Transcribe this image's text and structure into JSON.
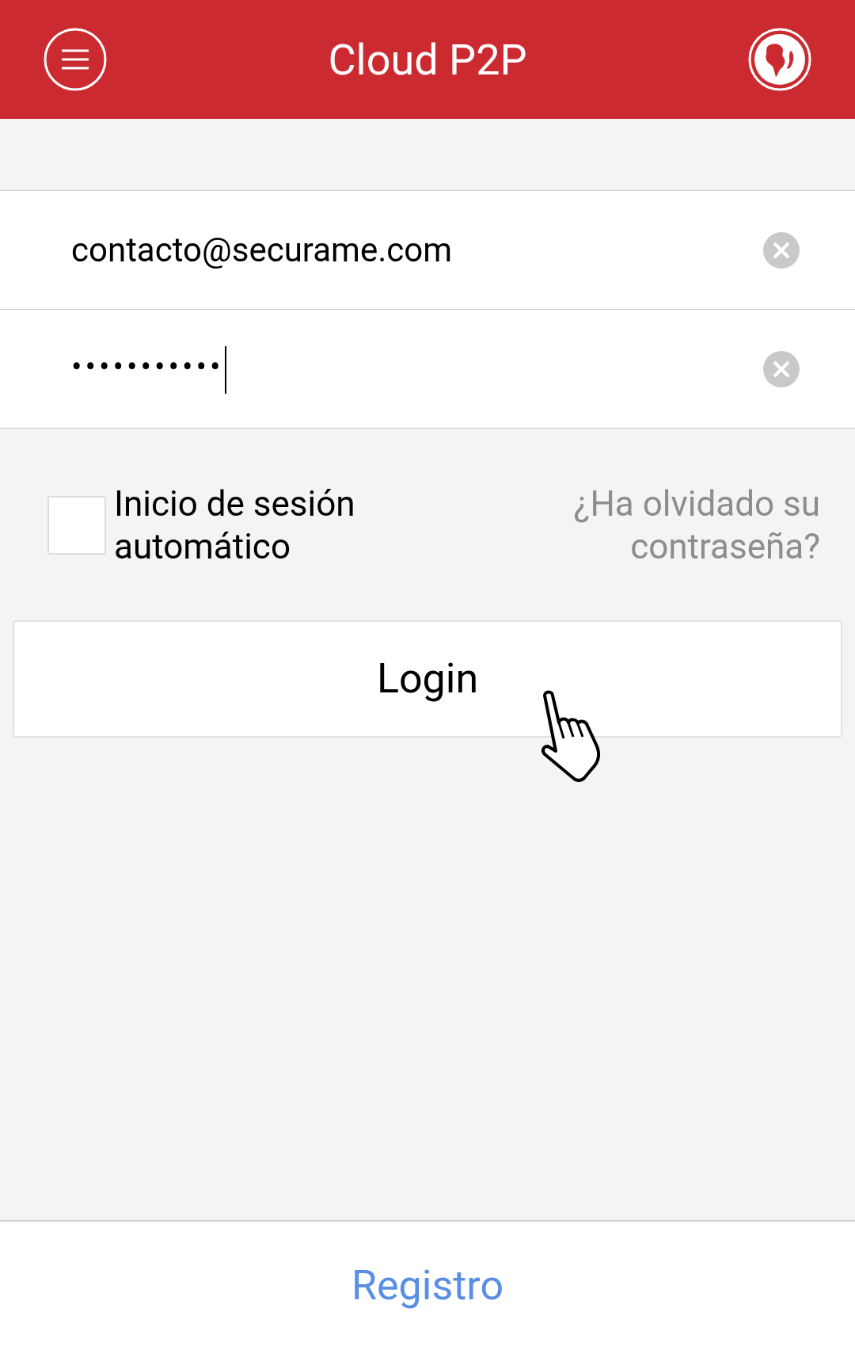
{
  "header": {
    "title": "Cloud P2P"
  },
  "fields": [
    {
      "kind": "email",
      "value": "contacto@securame.com",
      "focused": false
    },
    {
      "kind": "password",
      "value": "•••••••••••",
      "focused": true
    }
  ],
  "auto_login": {
    "label": "Inicio de sesión automático",
    "checked": false
  },
  "forgot_link": "¿Ha olvidado su contraseña?",
  "login_button": "Login",
  "register_button": "Registro"
}
